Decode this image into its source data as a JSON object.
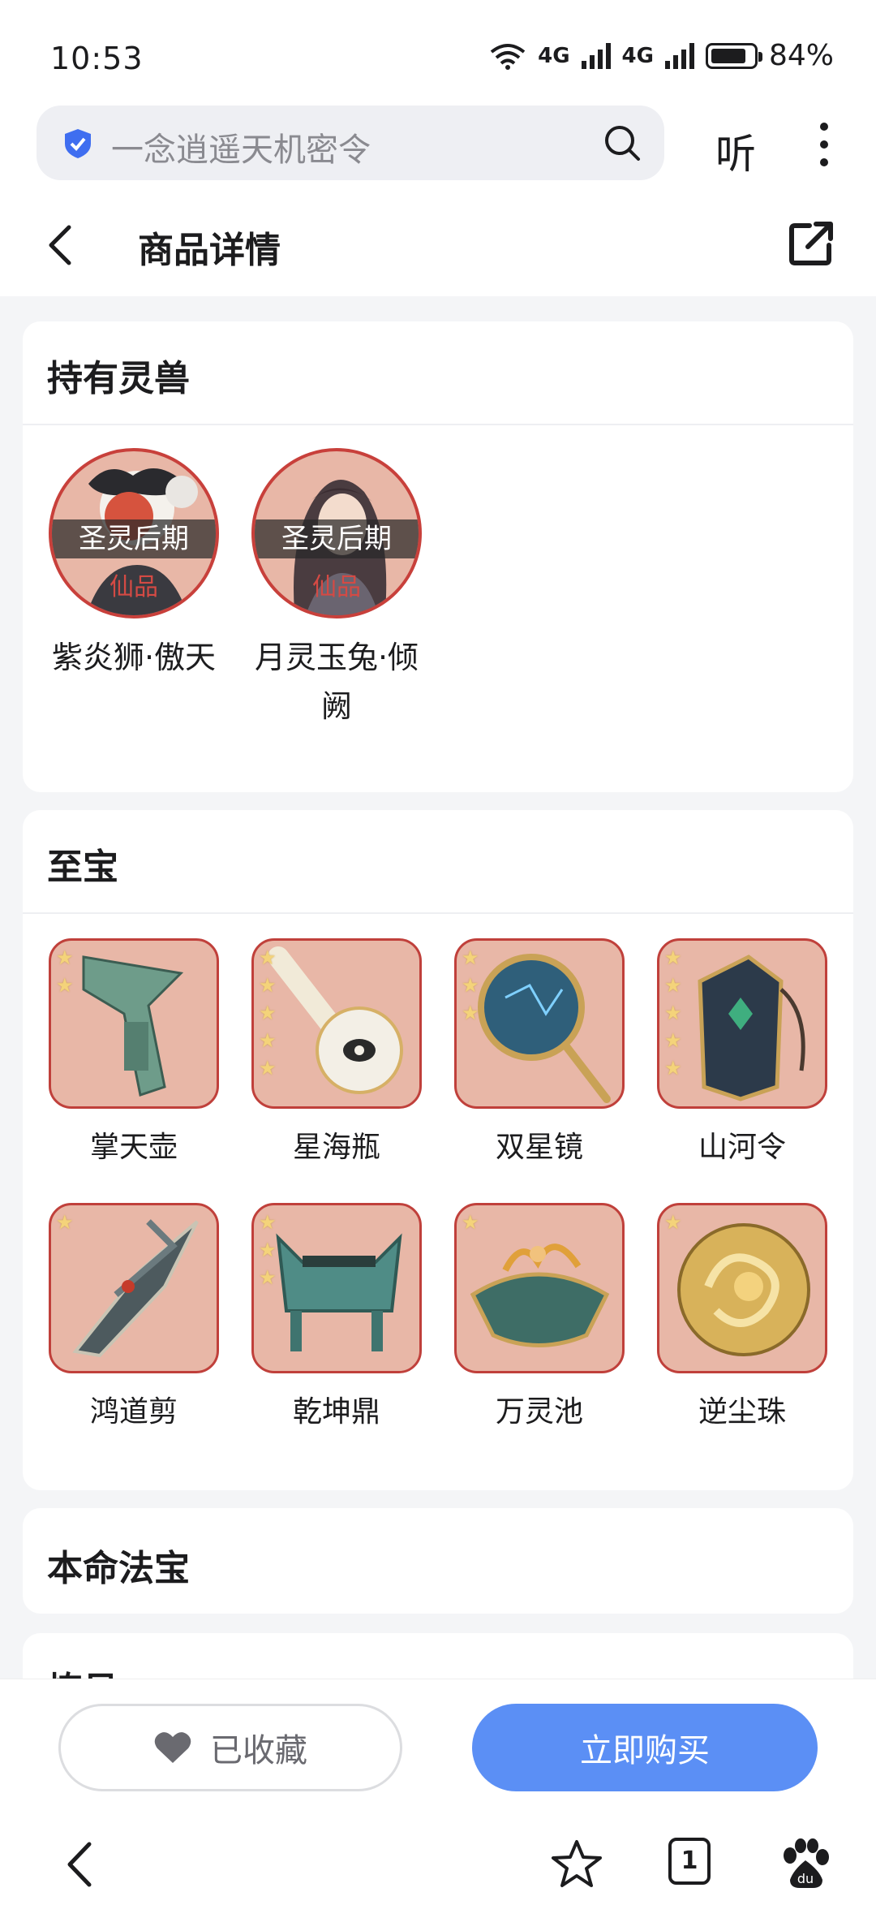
{
  "status_bar": {
    "time": "10:53",
    "signal_1": "4G",
    "signal_2": "4G",
    "battery_percent": "84%",
    "battery_level": 0.84
  },
  "search": {
    "placeholder": "一念逍遥天机密令",
    "listen_label": "听"
  },
  "header": {
    "title": "商品详情"
  },
  "pets_section": {
    "title": "持有灵兽",
    "items": [
      {
        "stage": "圣灵后期",
        "grade": "仙品",
        "name": "紫炎狮·傲天"
      },
      {
        "stage": "圣灵后期",
        "grade": "仙品",
        "name": "月灵玉兔·倾阙"
      }
    ]
  },
  "treasure_section": {
    "title": "至宝",
    "items": [
      {
        "name": "掌天壶",
        "stars": 2
      },
      {
        "name": "星海瓶",
        "stars": 5
      },
      {
        "name": "双星镜",
        "stars": 3
      },
      {
        "name": "山河令",
        "stars": 5
      },
      {
        "name": "鸿道剪",
        "stars": 1
      },
      {
        "name": "乾坤鼎",
        "stars": 3
      },
      {
        "name": "万灵池",
        "stars": 1
      },
      {
        "name": "逆尘珠",
        "stars": 1
      }
    ]
  },
  "fabao_section": {
    "title": "本命法宝"
  },
  "next_section": {
    "title_partial": "炼贝"
  },
  "actions": {
    "favorite_label": "已收藏",
    "buy_label": "立即购买"
  },
  "nav": {
    "tab_count": "1"
  },
  "colors": {
    "accent": "#5b8ff5",
    "tile_bg": "#e8b7a7",
    "tile_border": "#c0403b",
    "grade_red": "#d44a44"
  }
}
